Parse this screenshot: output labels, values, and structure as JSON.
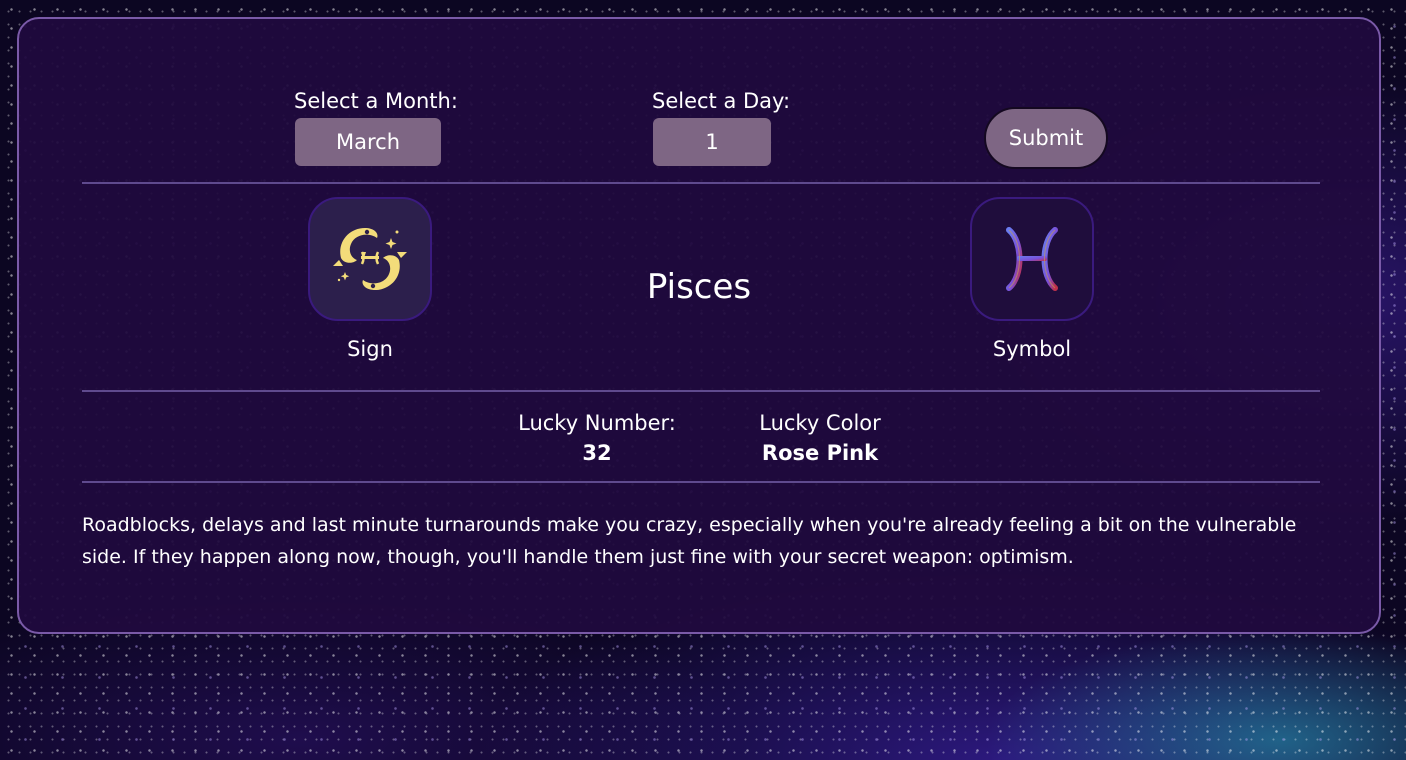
{
  "form": {
    "month_label": "Select a Month:",
    "month_value": "March",
    "day_label": "Select a Day:",
    "day_value": "1",
    "submit_label": "Submit"
  },
  "result": {
    "sign_name": "Pisces",
    "sign_caption": "Sign",
    "symbol_caption": "Symbol",
    "sign_icon": "pisces-fish-icon",
    "symbol_icon": "pisces-glyph-icon"
  },
  "lucky": {
    "number_label": "Lucky Number:",
    "number_value": "32",
    "color_label": "Lucky Color",
    "color_value": "Rose Pink"
  },
  "horoscope": {
    "text": "Roadblocks, delays and last minute turnarounds make you crazy, especially when you're already feeling a bit on the vulnerable side. If they happen along now, though, you'll handle them just fine with your secret weapon: optimism."
  },
  "colors": {
    "card_border": "#7a5aa8",
    "card_background": "#200a3e",
    "input_background": "#7e6684",
    "divider": "#5f4a8e",
    "sign_icon_gold": "#f3dc7a"
  }
}
